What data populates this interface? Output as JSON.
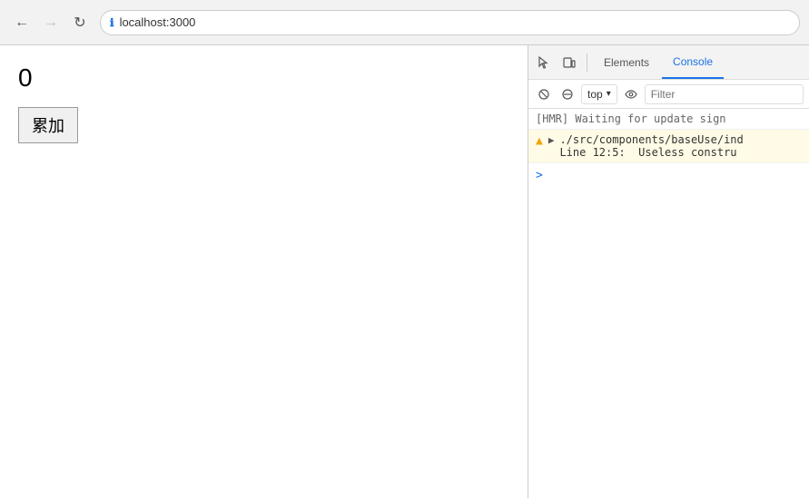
{
  "browser": {
    "address": "localhost:3000",
    "back_disabled": false,
    "forward_disabled": true
  },
  "devtools": {
    "tabs": [
      {
        "label": "Elements",
        "active": false
      },
      {
        "label": "Console",
        "active": true
      }
    ],
    "toolbar2": {
      "top_dropdown": "top",
      "filter_placeholder": "Filter"
    },
    "console_lines": [
      {
        "type": "hmr",
        "text": "[HMR] Waiting for update sign"
      },
      {
        "type": "warning",
        "text": "▶ ./src/components/baseUse/ind",
        "subtext": "Line 12:5:  Useless constru"
      },
      {
        "type": "prompt",
        "text": ">"
      }
    ]
  },
  "page": {
    "counter_value": "0",
    "button_label": "累加"
  }
}
